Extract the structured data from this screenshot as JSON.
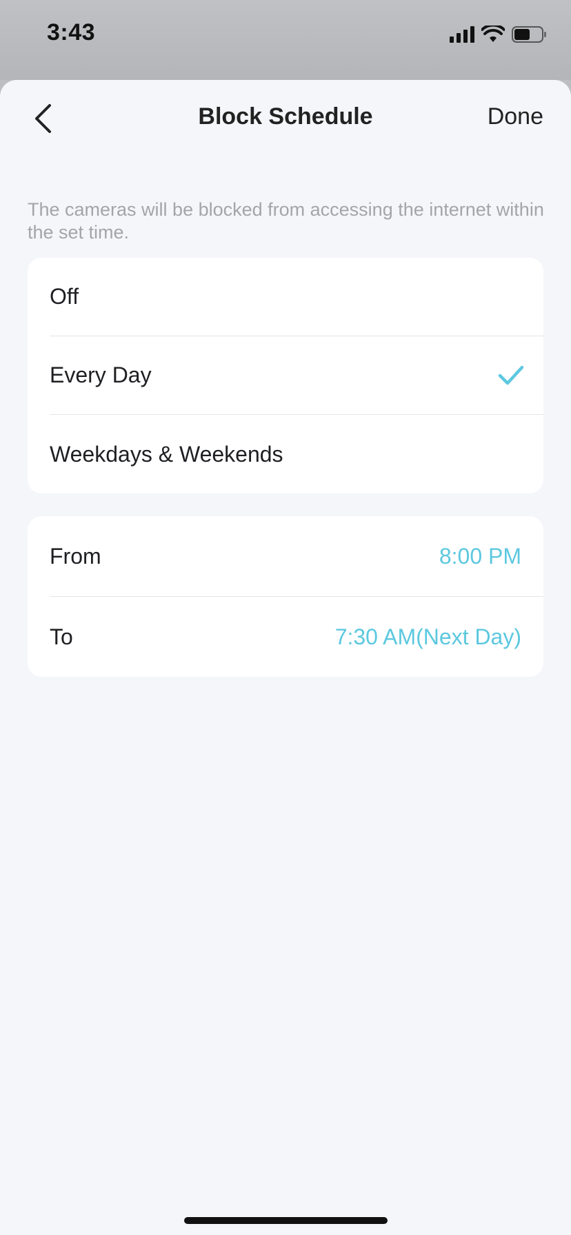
{
  "status_bar": {
    "time": "3:43",
    "icons": [
      "signal-icon",
      "wifi-icon",
      "battery-icon"
    ]
  },
  "nav": {
    "back_icon": "chevron-left-icon",
    "title": "Block Schedule",
    "done_label": "Done"
  },
  "description": "The cameras will be blocked from accessing the internet within the set time.",
  "schedule_options": {
    "items": [
      {
        "label": "Off",
        "selected": false
      },
      {
        "label": "Every Day",
        "selected": true
      },
      {
        "label": "Weekdays & Weekends",
        "selected": false
      }
    ]
  },
  "time_range": {
    "from_label": "From",
    "from_value": "8:00 PM",
    "to_label": "To",
    "to_value": "7:30 AM(Next Day)"
  },
  "colors": {
    "accent": "#5cc8df",
    "background": "#f4f6fa",
    "card": "#ffffff",
    "muted_text": "#a3a5aa"
  }
}
